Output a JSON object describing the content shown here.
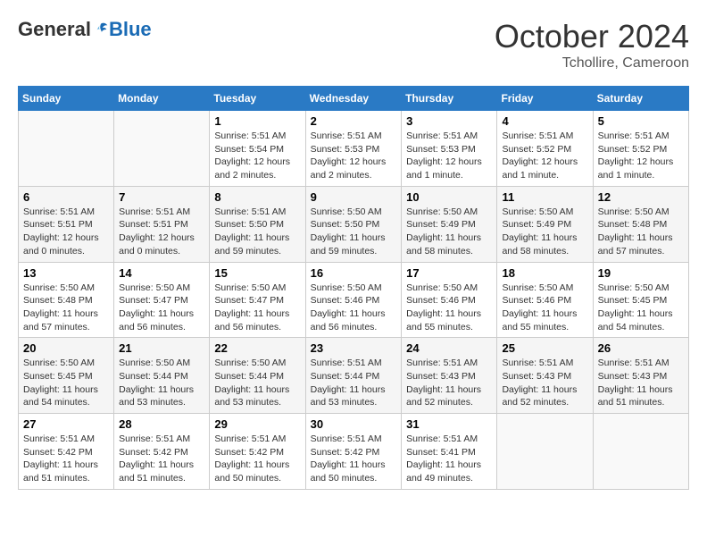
{
  "logo": {
    "general": "General",
    "blue": "Blue"
  },
  "title": "October 2024",
  "location": "Tchollire, Cameroon",
  "days_of_week": [
    "Sunday",
    "Monday",
    "Tuesday",
    "Wednesday",
    "Thursday",
    "Friday",
    "Saturday"
  ],
  "weeks": [
    [
      {
        "day": "",
        "info": ""
      },
      {
        "day": "",
        "info": ""
      },
      {
        "day": "1",
        "info": "Sunrise: 5:51 AM\nSunset: 5:54 PM\nDaylight: 12 hours and 2 minutes."
      },
      {
        "day": "2",
        "info": "Sunrise: 5:51 AM\nSunset: 5:53 PM\nDaylight: 12 hours and 2 minutes."
      },
      {
        "day": "3",
        "info": "Sunrise: 5:51 AM\nSunset: 5:53 PM\nDaylight: 12 hours and 1 minute."
      },
      {
        "day": "4",
        "info": "Sunrise: 5:51 AM\nSunset: 5:52 PM\nDaylight: 12 hours and 1 minute."
      },
      {
        "day": "5",
        "info": "Sunrise: 5:51 AM\nSunset: 5:52 PM\nDaylight: 12 hours and 1 minute."
      }
    ],
    [
      {
        "day": "6",
        "info": "Sunrise: 5:51 AM\nSunset: 5:51 PM\nDaylight: 12 hours and 0 minutes."
      },
      {
        "day": "7",
        "info": "Sunrise: 5:51 AM\nSunset: 5:51 PM\nDaylight: 12 hours and 0 minutes."
      },
      {
        "day": "8",
        "info": "Sunrise: 5:51 AM\nSunset: 5:50 PM\nDaylight: 11 hours and 59 minutes."
      },
      {
        "day": "9",
        "info": "Sunrise: 5:50 AM\nSunset: 5:50 PM\nDaylight: 11 hours and 59 minutes."
      },
      {
        "day": "10",
        "info": "Sunrise: 5:50 AM\nSunset: 5:49 PM\nDaylight: 11 hours and 58 minutes."
      },
      {
        "day": "11",
        "info": "Sunrise: 5:50 AM\nSunset: 5:49 PM\nDaylight: 11 hours and 58 minutes."
      },
      {
        "day": "12",
        "info": "Sunrise: 5:50 AM\nSunset: 5:48 PM\nDaylight: 11 hours and 57 minutes."
      }
    ],
    [
      {
        "day": "13",
        "info": "Sunrise: 5:50 AM\nSunset: 5:48 PM\nDaylight: 11 hours and 57 minutes."
      },
      {
        "day": "14",
        "info": "Sunrise: 5:50 AM\nSunset: 5:47 PM\nDaylight: 11 hours and 56 minutes."
      },
      {
        "day": "15",
        "info": "Sunrise: 5:50 AM\nSunset: 5:47 PM\nDaylight: 11 hours and 56 minutes."
      },
      {
        "day": "16",
        "info": "Sunrise: 5:50 AM\nSunset: 5:46 PM\nDaylight: 11 hours and 56 minutes."
      },
      {
        "day": "17",
        "info": "Sunrise: 5:50 AM\nSunset: 5:46 PM\nDaylight: 11 hours and 55 minutes."
      },
      {
        "day": "18",
        "info": "Sunrise: 5:50 AM\nSunset: 5:46 PM\nDaylight: 11 hours and 55 minutes."
      },
      {
        "day": "19",
        "info": "Sunrise: 5:50 AM\nSunset: 5:45 PM\nDaylight: 11 hours and 54 minutes."
      }
    ],
    [
      {
        "day": "20",
        "info": "Sunrise: 5:50 AM\nSunset: 5:45 PM\nDaylight: 11 hours and 54 minutes."
      },
      {
        "day": "21",
        "info": "Sunrise: 5:50 AM\nSunset: 5:44 PM\nDaylight: 11 hours and 53 minutes."
      },
      {
        "day": "22",
        "info": "Sunrise: 5:50 AM\nSunset: 5:44 PM\nDaylight: 11 hours and 53 minutes."
      },
      {
        "day": "23",
        "info": "Sunrise: 5:51 AM\nSunset: 5:44 PM\nDaylight: 11 hours and 53 minutes."
      },
      {
        "day": "24",
        "info": "Sunrise: 5:51 AM\nSunset: 5:43 PM\nDaylight: 11 hours and 52 minutes."
      },
      {
        "day": "25",
        "info": "Sunrise: 5:51 AM\nSunset: 5:43 PM\nDaylight: 11 hours and 52 minutes."
      },
      {
        "day": "26",
        "info": "Sunrise: 5:51 AM\nSunset: 5:43 PM\nDaylight: 11 hours and 51 minutes."
      }
    ],
    [
      {
        "day": "27",
        "info": "Sunrise: 5:51 AM\nSunset: 5:42 PM\nDaylight: 11 hours and 51 minutes."
      },
      {
        "day": "28",
        "info": "Sunrise: 5:51 AM\nSunset: 5:42 PM\nDaylight: 11 hours and 51 minutes."
      },
      {
        "day": "29",
        "info": "Sunrise: 5:51 AM\nSunset: 5:42 PM\nDaylight: 11 hours and 50 minutes."
      },
      {
        "day": "30",
        "info": "Sunrise: 5:51 AM\nSunset: 5:42 PM\nDaylight: 11 hours and 50 minutes."
      },
      {
        "day": "31",
        "info": "Sunrise: 5:51 AM\nSunset: 5:41 PM\nDaylight: 11 hours and 49 minutes."
      },
      {
        "day": "",
        "info": ""
      },
      {
        "day": "",
        "info": ""
      }
    ]
  ]
}
